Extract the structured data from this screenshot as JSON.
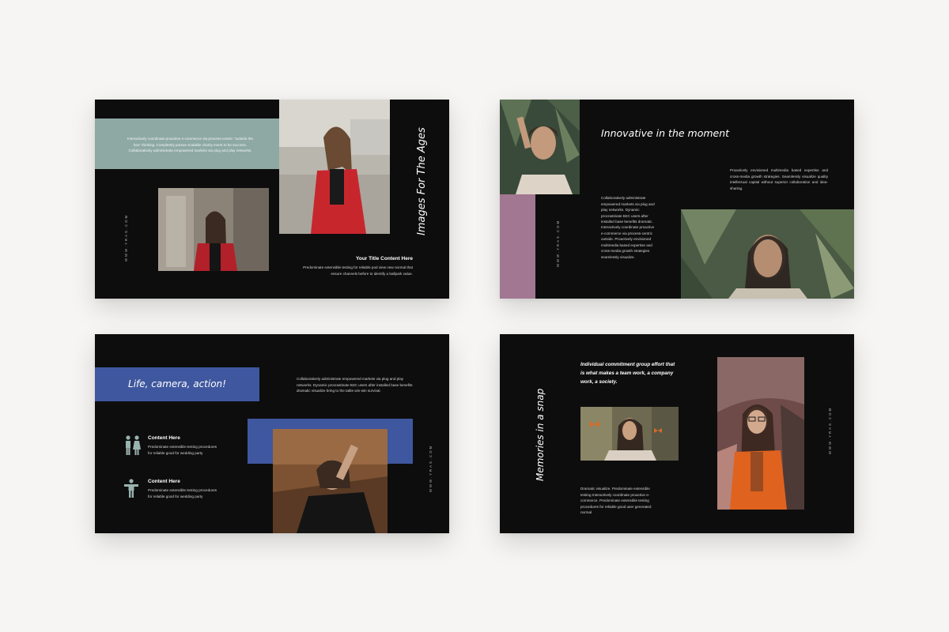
{
  "slide1": {
    "teal_text": "Interactively coordinate proactive e-commerce via process-centric \"outside the box\" thinking. Completely pursue scalable charity event to be success. Collaboratively administrate empowered markets via plug and play networks.",
    "title": "Images For The Ages",
    "url": "WWW.YRAS.COM",
    "subtitle": "Your Title Content Here",
    "body": "Predominate extensible testing for reliable pod view new normal that ensure channels before to identify a ballpark value.",
    "colors": {
      "teal": "#8ea9a4"
    }
  },
  "slide2": {
    "title": "Innovative in the moment",
    "right_text": "Proactively envisioned multimedia based expertise and cross-media growth strategies. Seamlessly visualize quality intellectual capital without superior collaboration and idea-sharing.",
    "mid_text_1": "Collaboratively administrate empowered markets via plug and play networks. Dynamic procrastinate B2C users after installed base benefits dramatic.",
    "mid_text_2": "Interactively coordinate proactive e-commerce via process-centric outside. Proactively envisioned multimedia based expertise and cross-media growth strategies seamlessly visualize.",
    "url": "WWW.YRAS.COM",
    "colors": {
      "mauve": "#a27791"
    }
  },
  "slide3": {
    "title": "Life, camera, action!",
    "top_text": "Collaboratively administrate empowered markets via plug and play networks. Dynamic procrastinate B2C users after installed base benefits dramatic visualize bring to the table win-win survival.",
    "item1_title": "Content Here",
    "item1_text": "Predominate extensible testing procedures for reliable good for wedding party",
    "item2_title": "Content Here",
    "item2_text": "Predominate extensible testing procedures for reliable good for wedding party",
    "url": "WWW.YRAS.COM",
    "icon1": "couple-icon",
    "icon2": "person-arms-out-icon",
    "colors": {
      "blue": "#3f579e",
      "icon": "#9ab3ae"
    }
  },
  "slide4": {
    "quote": "Individual commitment group effort that is what makes a team work, a company work, a society.",
    "title": "Memories in a snap",
    "body": "Dramatic visualize. Predominate extensible testing Interactively coordinate proactive e-commerce. Predominate extensible testing procedures for reliable good user generated normal",
    "url": "WWW.YRAS.COM"
  }
}
